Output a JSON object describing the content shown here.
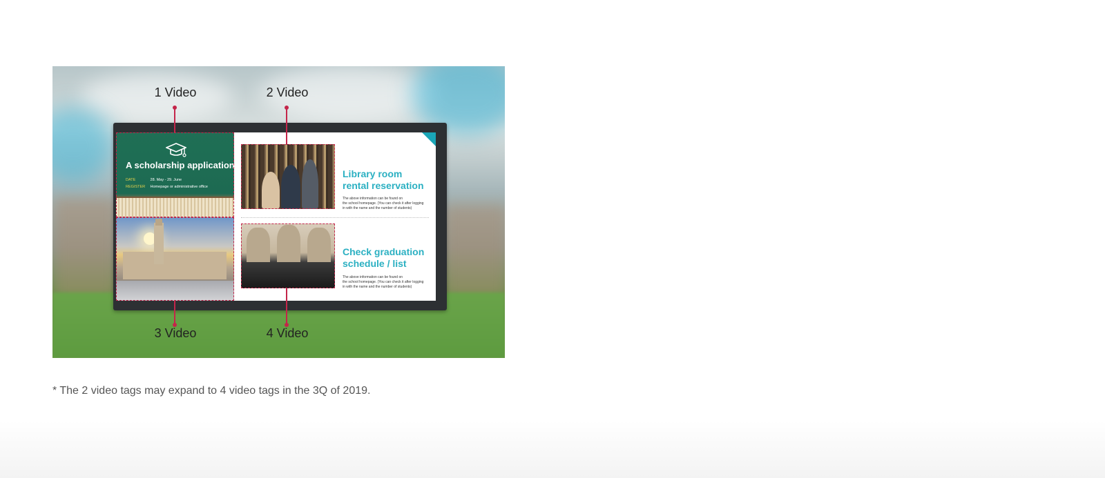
{
  "figure": {
    "callouts": [
      {
        "label": "1 Video"
      },
      {
        "label": "2 Video"
      },
      {
        "label": "3 Video"
      },
      {
        "label": "4 Video"
      }
    ],
    "accent_color": "#c4254a"
  },
  "screen": {
    "scholarship": {
      "title": "A scholarship application",
      "rows": [
        {
          "key": "DATE",
          "value": "28. May - 29. June"
        },
        {
          "key": "REGISTER",
          "value": "Homepage or administrative office"
        }
      ],
      "icon": "graduation-cap-icon"
    },
    "library": {
      "title_line1": "Library room",
      "title_line2": "rental reservation",
      "desc_line1": "The above information can be found on",
      "desc_line2": "the school homepage. (You can check it after logging",
      "desc_line3": "in with the name and the number of students)"
    },
    "graduation": {
      "title_line1": "Check graduation",
      "title_line2": "schedule / list",
      "desc_line1": "The above information can be found on",
      "desc_line2": "the school homepage. (You can check it after logging",
      "desc_line3": "in with the name and the number of students)"
    },
    "title_color": "#2bb0c2"
  },
  "footnote": "* The 2 video tags may expand to 4 video tags in the 3Q of 2019."
}
